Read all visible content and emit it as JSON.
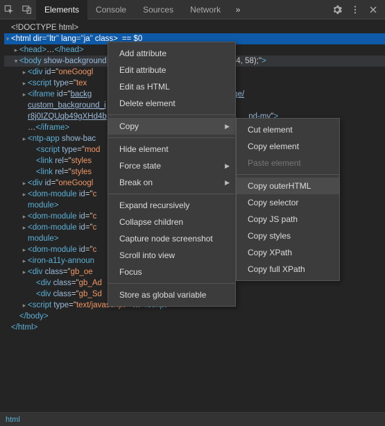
{
  "toolbar": {
    "tabs": [
      "Elements",
      "Console",
      "Sources",
      "Network"
    ],
    "active_tab": 0
  },
  "dom_lines": [
    {
      "indent": 0,
      "tw": "",
      "html": "<span class='txt'>&lt;!DOCTYPE html&gt;</span>"
    },
    {
      "indent": 0,
      "tw": "▾",
      "sel": true,
      "html": "<span class='tag'>&lt;html</span> <span class='attr'>dir</span>=\"<span class='val'>ltr</span>\" <span class='attr'>lang</span>=\"<span class='val'>ja</span>\" <span class='attr'>class</span><span class='tag'>&gt;</span><span class='eqpx'>== $0</span>"
    },
    {
      "indent": 1,
      "tw": "▸",
      "html": "<span class='tag'>&lt;head&gt;</span><span class='txt'>…</span><span class='tag'>&lt;/head&gt;</span>"
    },
    {
      "indent": 1,
      "tw": "▾",
      "hl": true,
      "html": "<span class='tag'>&lt;body</span> <span class='attr'>show-background</span>&nbsp;&nbsp;&nbsp;&nbsp;&nbsp;&nbsp;&nbsp;&nbsp;&nbsp;&nbsp;&nbsp;&nbsp;&nbsp;&nbsp;&nbsp;&nbsp;&nbsp;&nbsp;&nbsp;&nbsp;&nbsp;&nbsp;&nbsp;&nbsp;&nbsp;&nbsp;&nbsp;&nbsp;&nbsp;&nbsp;&nbsp;&nbsp;&nbsp;&nbsp;&nbsp;&nbsp;<span class='attr'>olor</span>: <span class='txt'>rgb(53, 54, 58);</span>\"<span class='tag'>&gt;</span>"
    },
    {
      "indent": 2,
      "tw": "▸",
      "html": "<span class='tag'>&lt;div</span> <span class='attr'>id</span>=\"<span class='val'>oneGoogl</span>"
    },
    {
      "indent": 2,
      "tw": "▸",
      "html": "<span class='tag'>&lt;script</span> <span class='attr'>type</span>=\"<span class='val'>tex</span>"
    },
    {
      "indent": 2,
      "tw": "▸",
      "html": "<span class='tag'>&lt;iframe</span> <span class='attr'>id</span>=\"<span class='val link'>backg</span>&nbsp;&nbsp;&nbsp;&nbsp;&nbsp;&nbsp;&nbsp;&nbsp;&nbsp;&nbsp;&nbsp;&nbsp;&nbsp;&nbsp;&nbsp;&nbsp;&nbsp;&nbsp;&nbsp;&nbsp;&nbsp;&nbsp;&nbsp;&nbsp;&nbsp;&nbsp;&nbsp;&nbsp;&nbsp;&nbsp;&nbsp;&nbsp;&nbsp;&nbsp;&nbsp;&nbsp;<span class='link'>sted://new-tab-page/</span>"
    },
    {
      "indent": 2,
      "tw": "",
      "html": "<span class='link'>custom_background_i</span>"
    },
    {
      "indent": 2,
      "tw": "",
      "html": "<span class='link'>r8j0IZQUqb49gXHd4b</span>&nbsp;&nbsp;&nbsp;&nbsp;&nbsp;&nbsp;&nbsp;&nbsp;&nbsp;&nbsp;&nbsp;&nbsp;&nbsp;&nbsp;&nbsp;&nbsp;&nbsp;&nbsp;&nbsp;&nbsp;&nbsp;&nbsp;&nbsp;&nbsp;&nbsp;&nbsp;&nbsp;&nbsp;&nbsp;&nbsp;&nbsp;&nbsp;&nbsp;&nbsp;&nbsp;&nbsp;&nbsp;&nbsp;&nbsp;&nbsp;&nbsp;&nbsp;&nbsp;&nbsp;&nbsp;&nbsp;&nbsp;&nbsp;&nbsp;&nbsp;&nbsp;&nbsp;&nbsp;&nbsp;&nbsp;&nbsp;&nbsp;&nbsp;&nbsp;&nbsp;&nbsp;&nbsp;&nbsp;&nbsp;<span class='link'>nd-mv</span>\"<span class='tag'>&gt;</span>"
    },
    {
      "indent": 2,
      "tw": "",
      "html": "<span class='txt'>…</span><span class='tag'>&lt;/iframe&gt;</span>"
    },
    {
      "indent": 2,
      "tw": "▸",
      "html": "<span class='tag'>&lt;ntp-app</span> <span class='attr'>show-bac</span>"
    },
    {
      "indent": 3,
      "tw": "",
      "html": "<span class='tag'>&lt;script</span> <span class='attr'>type</span>=\"<span class='val'>mod</span>"
    },
    {
      "indent": 3,
      "tw": "",
      "html": "<span class='tag'>&lt;link</span> <span class='attr'>rel</span>=\"<span class='val'>styles</span>&nbsp;&nbsp;&nbsp;&nbsp;&nbsp;&nbsp;&nbsp;&nbsp;&nbsp;&nbsp;&nbsp;&nbsp;&nbsp;&nbsp;&nbsp;&nbsp;&nbsp;&nbsp;&nbsp;&nbsp;&nbsp;&nbsp;&nbsp;&nbsp;&nbsp;&nbsp;&nbsp;&nbsp;&nbsp;&nbsp;&nbsp;&nbsp;&nbsp;&nbsp;&nbsp;&nbsp;&nbsp;&nbsp;&nbsp;&nbsp;&nbsp;&nbsp;&nbsp;&nbsp;&nbsp;&nbsp;&nbsp;&nbsp;&nbsp;&nbsp;&nbsp;&nbsp;&nbsp;&nbsp;&nbsp;&nbsp;&nbsp;&nbsp;&nbsp;&nbsp;&nbsp;&nbsp;&nbsp;&nbsp;<span class='link'>.css</span>\"<span class='tag'>&gt;</span>"
    },
    {
      "indent": 3,
      "tw": "",
      "html": "<span class='tag'>&lt;link</span> <span class='attr'>rel</span>=\"<span class='val'>styles</span>"
    },
    {
      "indent": 2,
      "tw": "▸",
      "html": "<span class='tag'>&lt;div</span> <span class='attr'>id</span>=\"<span class='val'>oneGoogl</span>"
    },
    {
      "indent": 2,
      "tw": "▸",
      "html": "<span class='tag'>&lt;dom-module</span> <span class='attr'>id</span>=\"<span class='val'>c</span>&nbsp;&nbsp;&nbsp;&nbsp;&nbsp;&nbsp;&nbsp;&nbsp;&nbsp;&nbsp;&nbsp;&nbsp;&nbsp;&nbsp;&nbsp;&nbsp;&nbsp;&nbsp;&nbsp;&nbsp;&nbsp;&nbsp;&nbsp;&nbsp;&nbsp;&nbsp;&nbsp;&nbsp;&nbsp;&nbsp;&nbsp;&nbsp;&nbsp;&nbsp;&nbsp;&nbsp;&nbsp;&nbsp;&nbsp;&nbsp;&nbsp;&nbsp;&nbsp;&nbsp;&nbsp;&nbsp;&nbsp;&nbsp;&nbsp;&nbsp;&nbsp;&nbsp;&nbsp;&nbsp;&nbsp;&nbsp;&nbsp;&nbsp;&nbsp;&nbsp;&nbsp;&nbsp;&nbsp;&nbsp;&nbsp;<span class='tag'>dom-</span>"
    },
    {
      "indent": 2,
      "tw": "",
      "html": "<span class='tag'>module&gt;</span>"
    },
    {
      "indent": 2,
      "tw": "▸",
      "html": "<span class='tag'>&lt;dom-module</span> <span class='attr'>id</span>=\"<span class='val'>c</span>&nbsp;&nbsp;&nbsp;&nbsp;&nbsp;&nbsp;&nbsp;&nbsp;&nbsp;&nbsp;&nbsp;&nbsp;&nbsp;&nbsp;&nbsp;&nbsp;&nbsp;&nbsp;&nbsp;&nbsp;&nbsp;&nbsp;&nbsp;&nbsp;&nbsp;&nbsp;&nbsp;&nbsp;&nbsp;&nbsp;&nbsp;&nbsp;&nbsp;&nbsp;&nbsp;&nbsp;&nbsp;&nbsp;&nbsp;&nbsp;&nbsp;&nbsp;&nbsp;&nbsp;&nbsp;&nbsp;&nbsp;&nbsp;&nbsp;&nbsp;&nbsp;&nbsp;&nbsp;&nbsp;&nbsp;&nbsp;&nbsp;&nbsp;&nbsp;&nbsp;&nbsp;&nbsp;&nbsp;&nbsp;<span class='tag'>ule&gt;</span>"
    },
    {
      "indent": 2,
      "tw": "▸",
      "html": "<span class='tag'>&lt;dom-module</span> <span class='attr'>id</span>=\"<span class='val'>c</span>&nbsp;&nbsp;&nbsp;&nbsp;&nbsp;&nbsp;&nbsp;&nbsp;&nbsp;&nbsp;&nbsp;&nbsp;&nbsp;&nbsp;&nbsp;&nbsp;&nbsp;&nbsp;&nbsp;&nbsp;&nbsp;&nbsp;&nbsp;&nbsp;&nbsp;&nbsp;&nbsp;&nbsp;&nbsp;&nbsp;&nbsp;&nbsp;&nbsp;&nbsp;&nbsp;&nbsp;&nbsp;&nbsp;&nbsp;&nbsp;&nbsp;&nbsp;&nbsp;&nbsp;&nbsp;&nbsp;&nbsp;&nbsp;&nbsp;&nbsp;&nbsp;&nbsp;&nbsp;&nbsp;&nbsp;&nbsp;&nbsp;&nbsp;&nbsp;&nbsp;&nbsp;&nbsp;&nbsp;&nbsp;&nbsp;<span class='tag'>dom-</span>"
    },
    {
      "indent": 2,
      "tw": "",
      "html": "<span class='tag'>module&gt;</span>"
    },
    {
      "indent": 2,
      "tw": "▸",
      "html": "<span class='tag'>&lt;dom-module</span> <span class='attr'>id</span>=\"<span class='val'>c</span>&nbsp;&nbsp;&nbsp;&nbsp;&nbsp;&nbsp;&nbsp;&nbsp;&nbsp;&nbsp;&nbsp;&nbsp;&nbsp;&nbsp;&nbsp;&nbsp;&nbsp;&nbsp;&nbsp;&nbsp;&nbsp;&nbsp;&nbsp;&nbsp;&nbsp;&nbsp;&nbsp;&nbsp;&nbsp;&nbsp;&nbsp;&nbsp;&nbsp;&nbsp;&nbsp;&nbsp;&nbsp;&nbsp;&nbsp;&nbsp;&nbsp;&nbsp;&nbsp;&nbsp;&nbsp;&nbsp;&nbsp;&nbsp;&nbsp;&nbsp;&nbsp;&nbsp;&nbsp;&nbsp;&nbsp;&nbsp;&nbsp;&nbsp;&nbsp;&nbsp;&nbsp;&nbsp;&nbsp;&nbsp;<span class='tag'>om-module&gt;</span>"
    },
    {
      "indent": 2,
      "tw": "▸",
      "html": "<span class='tag'>&lt;iron-a11y-announ</span>"
    },
    {
      "indent": 2,
      "tw": "▸",
      "html": "<span class='tag'>&lt;div</span> <span class='attr'>class</span>=\"<span class='val'>gb_oe</span>"
    },
    {
      "indent": 3,
      "tw": "",
      "html": "<span class='tag'>&lt;div</span> <span class='attr'>class</span>=\"<span class='val'>gb_Ad</span>"
    },
    {
      "indent": 3,
      "tw": "",
      "html": "<span class='tag'>&lt;div</span> <span class='attr'>class</span>=\"<span class='val'>gb_Sd</span>"
    },
    {
      "indent": 2,
      "tw": "▸",
      "html": "<span class='tag'>&lt;script</span> <span class='attr'>type</span>=\"<span class='val'>text/javascript</span>\"<span class='tag'>&gt;</span><span class='txt'>…</span><span class='tag'>&lt;/script&gt;</span>"
    },
    {
      "indent": 1,
      "tw": "",
      "html": "<span class='tag'>&lt;/body&gt;</span>"
    },
    {
      "indent": 0,
      "tw": "",
      "html": "<span class='tag'>&lt;/html&gt;</span>"
    }
  ],
  "context_menu": {
    "groups": [
      [
        "Add attribute",
        "Edit attribute",
        "Edit as HTML",
        "Delete element"
      ],
      [
        {
          "label": "Copy",
          "sub": true,
          "hov": true
        }
      ],
      [
        "Hide element",
        {
          "label": "Force state",
          "sub": true
        },
        {
          "label": "Break on",
          "sub": true
        }
      ],
      [
        "Expand recursively",
        "Collapse children",
        "Capture node screenshot",
        "Scroll into view",
        "Focus"
      ],
      [
        "Store as global variable"
      ]
    ]
  },
  "submenu": {
    "items": [
      "Cut element",
      "Copy element",
      {
        "label": "Paste element",
        "dis": true
      },
      "---",
      {
        "label": "Copy outerHTML",
        "hov": true
      },
      "Copy selector",
      "Copy JS path",
      "Copy styles",
      "Copy XPath",
      "Copy full XPath"
    ]
  },
  "breadcrumb": "html"
}
